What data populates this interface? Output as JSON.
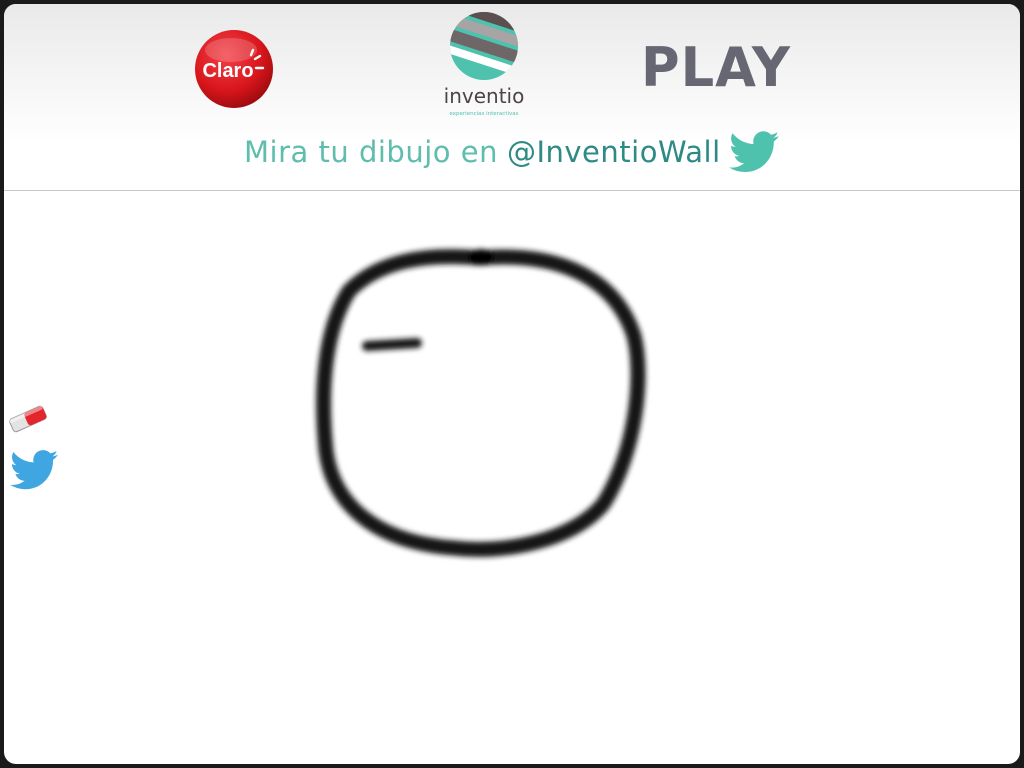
{
  "header": {
    "sponsor_logo": {
      "text": "Claro",
      "icon": "claro-logo"
    },
    "brand_logo": {
      "name": "inventio",
      "tagline": "experiencias interactivas",
      "icon": "inventio-logo"
    },
    "partner_logo": {
      "text": "PLAY",
      "icon": "play-logo"
    },
    "tagline": {
      "text": "Mira tu dibujo en",
      "handle": "@InventioWall",
      "icon": "twitter-bird-icon"
    }
  },
  "canvas": {
    "drawing": "freehand black circle sketch",
    "brush_color": "#141414"
  },
  "tools": [
    {
      "name": "eraser",
      "icon": "eraser-icon"
    },
    {
      "name": "twitter",
      "icon": "twitter-icon"
    }
  ],
  "colors": {
    "teal": "#5fbdae",
    "teal_dark": "#2d8a85",
    "claro_red": "#d8161b",
    "play_gray": "#676773",
    "twitter_blue": "#3fa6e2"
  }
}
